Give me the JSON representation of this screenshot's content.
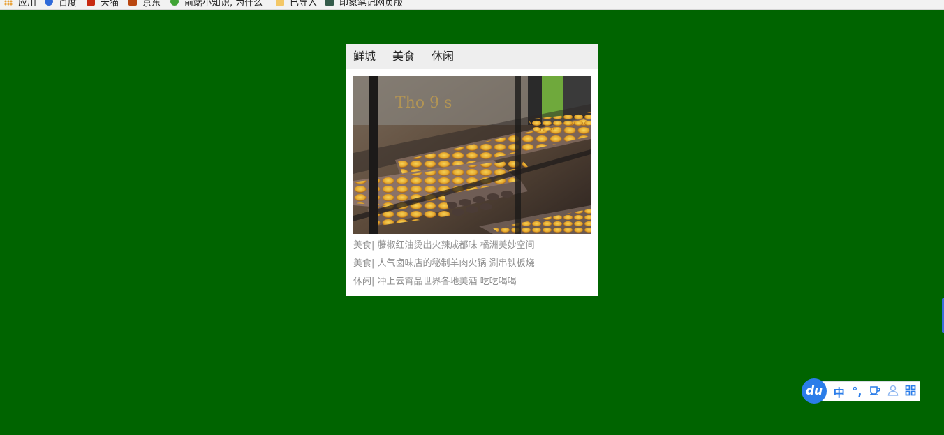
{
  "bookmarks": [
    {
      "label": "应用",
      "icon": "apps-grid-icon"
    },
    {
      "label": "百度",
      "icon": "baidu-icon"
    },
    {
      "label": "天猫",
      "icon": "tmall-icon"
    },
    {
      "label": "京东",
      "icon": "jd-icon"
    },
    {
      "label": "前端小知识, 为什么",
      "icon": "wechat-icon"
    },
    {
      "label": "已导入",
      "icon": "folder-icon"
    },
    {
      "label": "印象笔记网页版",
      "icon": "evernote-icon"
    }
  ],
  "card": {
    "tabs": [
      "鲜城",
      "美食",
      "休闲"
    ],
    "photo_alt": "egg-tarts",
    "news": [
      "美食| 藤椒红油烫出火辣成都味 橘洲美妙空间",
      "美食| 人气卤味店的秘制羊肉火锅 涮串铁板烧",
      "休闲| 冲上云霄品世界各地美酒 吃吃喝喝"
    ]
  },
  "ime": {
    "logo": "du",
    "buttons": [
      "中",
      "°,",
      "☕",
      "👤",
      "▦"
    ]
  },
  "colors": {
    "background": "#006400",
    "tab_bar": "#eeeeee",
    "news_text": "#8f8f8f",
    "ime_accent": "#2b7de9"
  }
}
